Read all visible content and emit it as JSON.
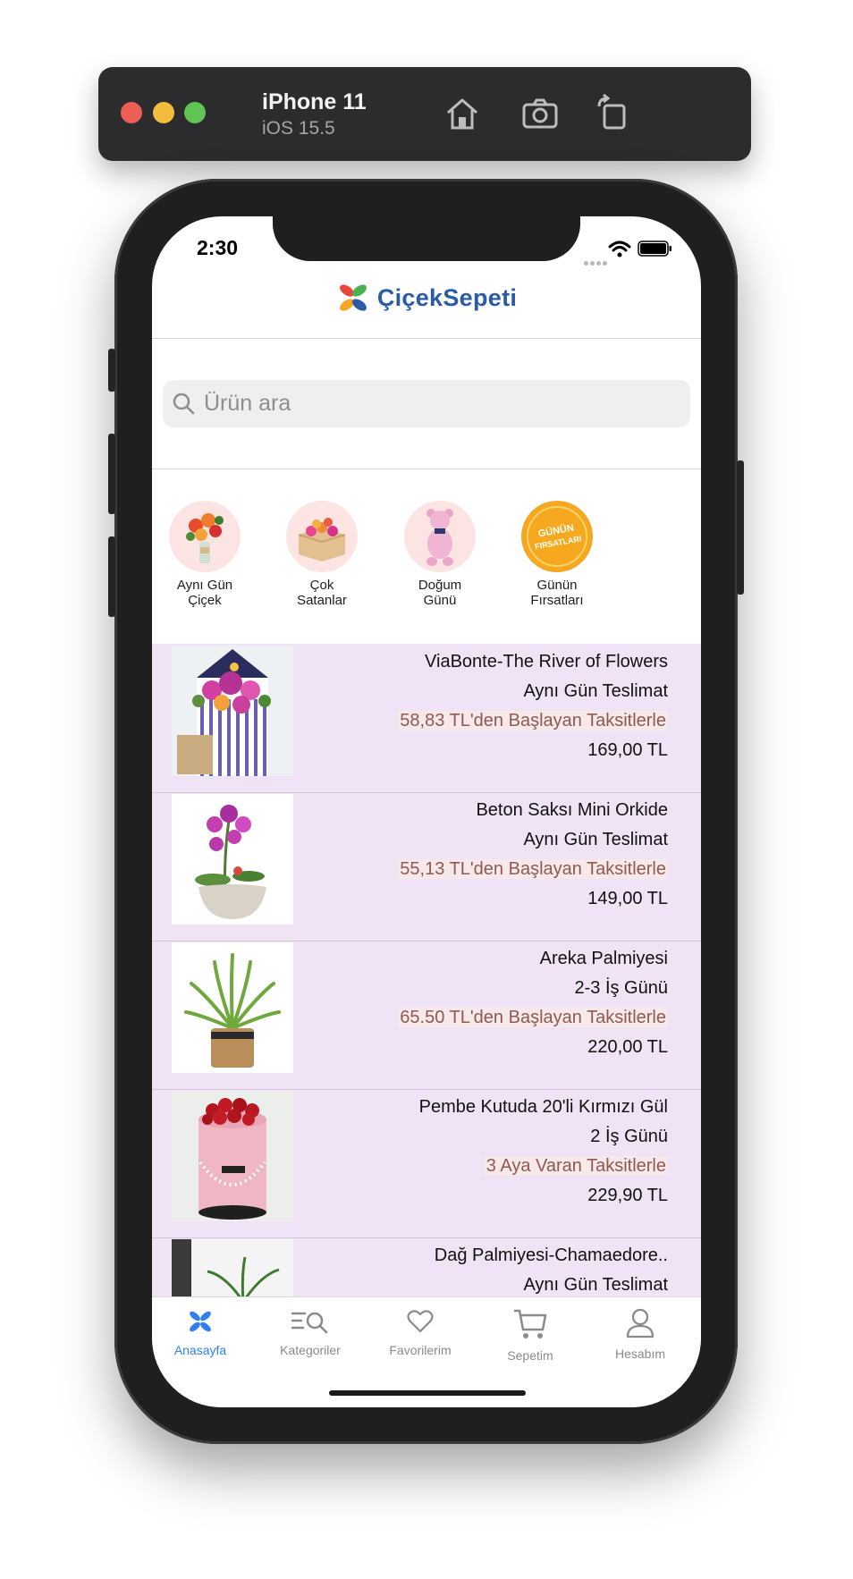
{
  "simulator": {
    "device": "iPhone 11",
    "os": "iOS 15.5"
  },
  "status": {
    "time": "2:30"
  },
  "app": {
    "logo_text": "ÇiçekSepeti"
  },
  "search": {
    "placeholder": "Ürün ara"
  },
  "categories": [
    {
      "label": "Aynı Gün\nÇiçek",
      "icon": "bouquet-icon"
    },
    {
      "label": "Çok\nSatanlar",
      "icon": "flower-box-icon"
    },
    {
      "label": "Doğum\nGünü",
      "icon": "teddy-bear-icon"
    },
    {
      "label": "Günün\nFırsatları",
      "icon": "deal-badge-icon",
      "badge_text": "GÜNÜN FIRSATLARI"
    }
  ],
  "products": [
    {
      "name": "ViaBonte-The River of Flowers",
      "delivery": "Aynı Gün Teslimat",
      "installment": "58,83 TL'den Başlayan Taksitlerle",
      "price": "169,00 TL"
    },
    {
      "name": "Beton Saksı Mini Orkide",
      "delivery": "Aynı Gün Teslimat",
      "installment": "55,13 TL'den Başlayan Taksitlerle",
      "price": "149,00 TL"
    },
    {
      "name": "Areka Palmiyesi",
      "delivery": "2-3 İş Günü",
      "installment": "65.50 TL'den Başlayan Taksitlerle",
      "price": "220,00 TL"
    },
    {
      "name": "Pembe Kutuda 20'li Kırmızı Gül",
      "delivery": "2 İş Günü",
      "installment": "3 Aya Varan Taksitlerle",
      "price": "229,90 TL"
    },
    {
      "name": "Dağ Palmiyesi-Chamaedore..",
      "delivery": "Aynı Gün Teslimat"
    }
  ],
  "tabs": [
    {
      "label": "Anasayfa",
      "icon": "home-flower-icon",
      "active": true
    },
    {
      "label": "Kategoriler",
      "icon": "categories-icon",
      "active": false
    },
    {
      "label": "Favorilerim",
      "icon": "heart-icon",
      "active": false
    },
    {
      "label": "Sepetim",
      "icon": "cart-icon",
      "active": false
    },
    {
      "label": "Hesabım",
      "icon": "account-icon",
      "active": false
    }
  ],
  "colors": {
    "accent": "#2f80ed",
    "list_bg": "#efe3f5",
    "installment_text": "#8e5a52",
    "installment_bg": "#f7e8ea"
  }
}
